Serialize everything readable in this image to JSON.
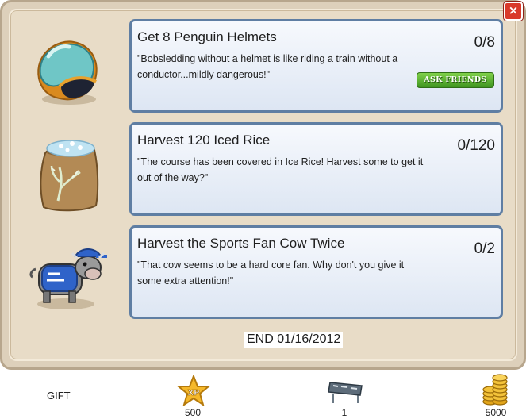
{
  "quests": [
    {
      "title": "Get 8 Penguin Helmets",
      "description": "\"Bobsledding without a helmet is like riding a train without a conductor...mildly dangerous!\"",
      "progress": "0/8",
      "icon": "penguin-helmet-icon",
      "action_label": "ASK FRIENDS"
    },
    {
      "title": "Harvest 120 Iced Rice",
      "description": "\"The course has been covered in Ice Rice! Harvest some to get it out of the way?\"",
      "progress": "0/120",
      "icon": "iced-rice-sack-icon"
    },
    {
      "title": "Harvest the Sports Fan Cow Twice",
      "description": "\"That cow seems to be a hard core fan. Why don't you give it some extra attention!\"",
      "progress": "0/2",
      "icon": "sports-fan-cow-icon"
    }
  ],
  "end_date": "END 01/16/2012",
  "close_label": "×",
  "rewards": {
    "gift_label": "GIFT",
    "xp": {
      "icon": "xp-star-icon",
      "value": "500",
      "star_text": "XP"
    },
    "item": {
      "icon": "bobsled-sign-icon",
      "value": "1"
    },
    "coins": {
      "icon": "gold-coins-icon",
      "value": "5000"
    }
  },
  "colors": {
    "panel_bg": "#e8dcc7",
    "card_border": "#5f7ea3",
    "card_bg": "#eef2f9",
    "ask_button": "#4fa82a",
    "close_button": "#d93a2b"
  }
}
